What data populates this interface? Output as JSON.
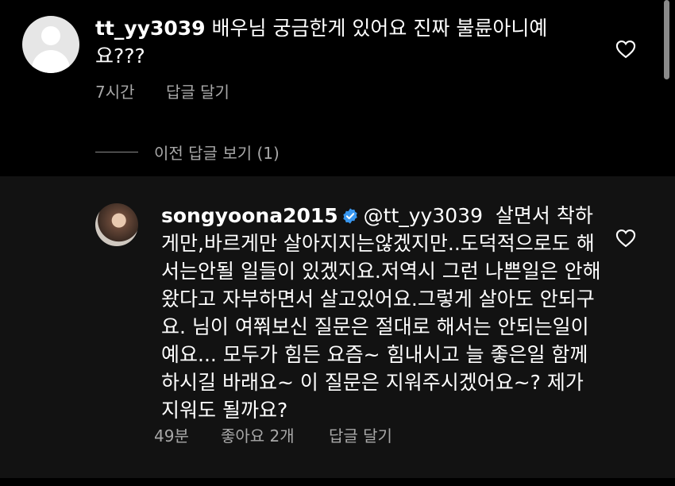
{
  "top_comment": {
    "username": "tt_yy3039",
    "text": "배우님 궁금한게 있어요 진짜 불륜아니예요???",
    "time": "7시간",
    "reply_label": "답글 달기"
  },
  "view_previous_replies": "이전 답글 보기 (1)",
  "reply": {
    "username": "songyoona2015",
    "mention": "@tt_yy3039",
    "text": "살면서 착하게만,바르게만 살아지지는않겠지만..도덕적으로도 해서는안될 일들이 있겠지요.저역시 그런 나쁜일은 안해왔다고 자부하면서 살고있어요.그렇게 살아도 안되구요. 님이 여쭤보신 질문은 절대로 해서는 안되는일이예요... 모두가 힘든 요즘~ 힘내시고 늘 좋은일 함께하시길 바래요~ 이 질문은 지워주시겠어요~? 제가 지워도 될까요?",
    "time": "49분",
    "likes": "좋아요 2개",
    "reply_label": "답글 달기"
  },
  "icons": {
    "like": "heart-outline-icon",
    "verified": "verified-badge-icon",
    "avatar_default": "default-avatar-icon"
  },
  "colors": {
    "background": "#000000",
    "reply_highlight": "#121212",
    "meta_text": "#a8a8a8",
    "verified_blue": "#3897f0"
  }
}
